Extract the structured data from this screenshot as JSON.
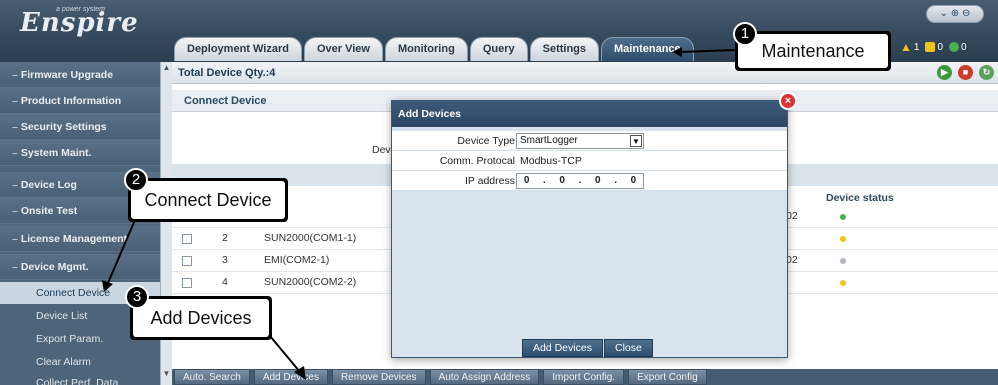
{
  "app": {
    "logo": "Enspire",
    "logo_tag": "a power system",
    "top_controls": "⌄ ⊕ ⊖"
  },
  "tabs": [
    {
      "label": "Deployment Wizard"
    },
    {
      "label": "Over View"
    },
    {
      "label": "Monitoring"
    },
    {
      "label": "Query"
    },
    {
      "label": "Settings"
    },
    {
      "label": "Maintenance"
    }
  ],
  "alarms": [
    {
      "count": "1",
      "color": "#f0c419"
    },
    {
      "count": "0",
      "color": "#f0c419"
    },
    {
      "count": "0",
      "color": "#4caf50"
    }
  ],
  "sidebar": {
    "items": [
      {
        "label": "Firmware Upgrade"
      },
      {
        "label": "Product Information"
      },
      {
        "label": "Security Settings"
      },
      {
        "label": "System Maint."
      },
      {
        "label": "Device Log"
      },
      {
        "label": "Onsite Test"
      },
      {
        "label": "License Management"
      },
      {
        "label": "Device Mgmt."
      }
    ],
    "subitems": [
      {
        "label": "Connect Device"
      },
      {
        "label": "Device List"
      },
      {
        "label": "Export Param."
      },
      {
        "label": "Clear Alarm"
      },
      {
        "label": "Collect Perf. Data"
      }
    ]
  },
  "main": {
    "qty": "Total Device Qty.:4",
    "section": "Connect Device",
    "dev_label": "Dev",
    "status_header": "Device status",
    "rows": [
      {
        "no": "",
        "name": ")",
        "addr": "02",
        "status_color": "#4caf50"
      },
      {
        "no": "2",
        "name": "SUN2000(COM1-1)",
        "addr": "",
        "status_color": "#f0c419"
      },
      {
        "no": "3",
        "name": "EMI(COM2-1)",
        "addr": "02",
        "status_color": "#b0b8bf"
      },
      {
        "no": "4",
        "name": "SUN2000(COM2-2)",
        "addr": "",
        "status_color": "#f0c419"
      }
    ],
    "bottom_buttons": [
      {
        "label": "Auto. Search"
      },
      {
        "label": "Add Devices"
      },
      {
        "label": "Remove Devices"
      },
      {
        "label": "Auto Assign Address"
      },
      {
        "label": "Import Config."
      },
      {
        "label": "Export Config"
      }
    ]
  },
  "dialog": {
    "title": "Add Devices",
    "device_type_label": "Device Type",
    "device_type_value": "SmartLogger",
    "protocol_label": "Comm. Protocal",
    "protocol_value": "Modbus-TCP",
    "ip_label": "IP address",
    "ip_octets": [
      "0",
      "0",
      "0",
      "0"
    ],
    "add_button": "Add Devices",
    "close_button": "Close"
  },
  "callouts": [
    {
      "num": "1",
      "text": "Maintenance"
    },
    {
      "num": "2",
      "text": "Connect Device"
    },
    {
      "num": "3",
      "text": "Add Devices"
    }
  ]
}
